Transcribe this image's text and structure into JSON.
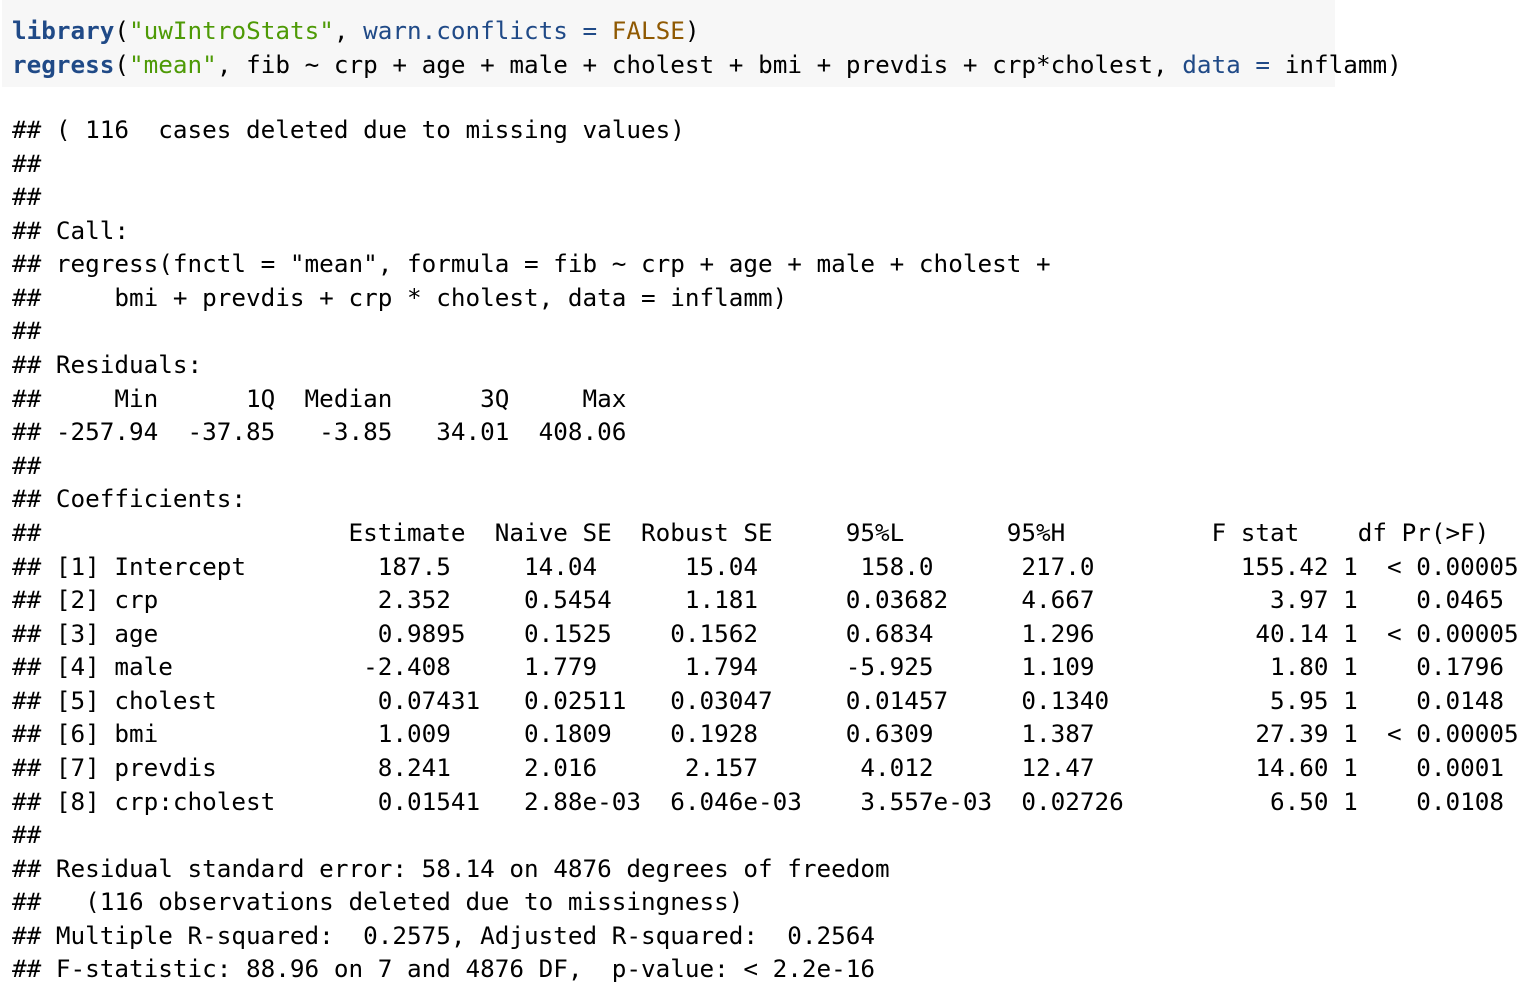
{
  "code": {
    "line1": {
      "fn": "library",
      "open": "(",
      "pkg": "\"uwIntroStats\"",
      "sep": ", ",
      "arg": "warn.conflicts",
      "eq": " = ",
      "value": "FALSE",
      "close": ")"
    },
    "line2": {
      "fn": "regress",
      "open": "(",
      "fnctl": "\"mean\"",
      "formula": ", fib ~ crp + age + male + cholest + bmi + prevdis + crp*cholest, ",
      "arg": "data",
      "eq": " = ",
      "value": "inflamm)"
    }
  },
  "output": {
    "lines": [
      "## ( 116  cases deleted due to missing values)",
      "##",
      "##",
      "## Call:",
      "## regress(fnctl = \"mean\", formula = fib ~ crp + age + male + cholest +",
      "##     bmi + prevdis + crp * cholest, data = inflamm)",
      "##",
      "## Residuals:",
      "##     Min      1Q  Median      3Q     Max",
      "## -257.94  -37.85   -3.85   34.01  408.06",
      "##",
      "## Coefficients:",
      "##                     Estimate  Naive SE  Robust SE     95%L       95%H          F stat    df Pr(>F)",
      "## [1] Intercept         187.5     14.04      15.04       158.0      217.0          155.42 1  < 0.00005",
      "## [2] crp               2.352     0.5454     1.181      0.03682     4.667            3.97 1    0.0465",
      "## [3] age               0.9895    0.1525    0.1562      0.6834      1.296           40.14 1  < 0.00005",
      "## [4] male             -2.408     1.779      1.794      -5.925      1.109            1.80 1    0.1796",
      "## [5] cholest           0.07431   0.02511   0.03047     0.01457     0.1340           5.95 1    0.0148",
      "## [6] bmi               1.009     0.1809    0.1928      0.6309      1.387           27.39 1  < 0.00005",
      "## [7] prevdis           8.241     2.016      2.157       4.012      12.47           14.60 1    0.0001",
      "## [8] crp:cholest       0.01541   2.88e-03  6.046e-03    3.557e-03  0.02726          6.50 1    0.0108",
      "##",
      "## Residual standard error: 58.14 on 4876 degrees of freedom",
      "##   (116 observations deleted due to missingness)",
      "## Multiple R-squared:  0.2575, Adjusted R-squared:  0.2564",
      "## F-statistic: 88.96 on 7 and 4876 DF,  p-value: < 2.2e-16"
    ]
  }
}
